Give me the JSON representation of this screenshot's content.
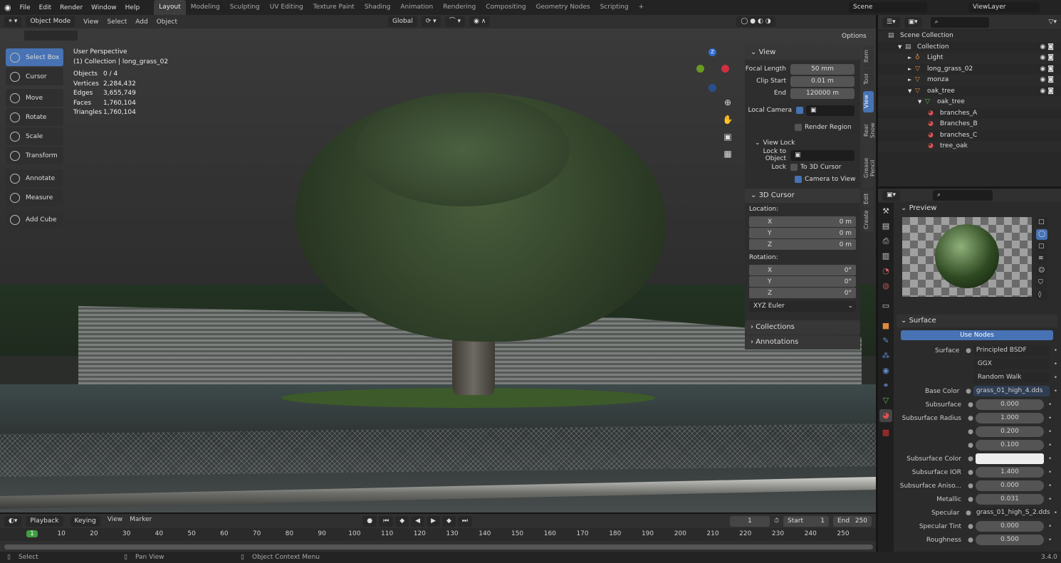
{
  "menu": [
    "File",
    "Edit",
    "Render",
    "Window",
    "Help"
  ],
  "workspaces": [
    "Layout",
    "Modeling",
    "Sculpting",
    "UV Editing",
    "Texture Paint",
    "Shading",
    "Animation",
    "Rendering",
    "Compositing",
    "Geometry Nodes",
    "Scripting",
    "+"
  ],
  "active_workspace": "Layout",
  "scene": "Scene",
  "view_layer": "ViewLayer",
  "viewport_header": {
    "mode": "Object Mode",
    "menus": [
      "View",
      "Select",
      "Add",
      "Object"
    ],
    "orientation": "Global",
    "options": "Options"
  },
  "toolbar": [
    "Select Box",
    "Cursor",
    "Move",
    "Rotate",
    "Scale",
    "Transform",
    "Annotate",
    "Measure",
    "Add Cube"
  ],
  "overlay": {
    "title": "User Perspective",
    "subtitle": "(1) Collection | long_grass_02",
    "stats": [
      [
        "Objects",
        "0 / 4"
      ],
      [
        "Vertices",
        "2,284,432"
      ],
      [
        "Edges",
        "3,655,749"
      ],
      [
        "Faces",
        "1,760,104"
      ],
      [
        "Triangles",
        "1,760,104"
      ]
    ]
  },
  "npanel": {
    "view_header": "View",
    "focal_label": "Focal Length",
    "focal": "50 mm",
    "clip_start_label": "Clip Start",
    "clip_start": "0.01 m",
    "end_label": "End",
    "end": "120000 m",
    "local_camera": "Local Camera",
    "render_region": "Render Region",
    "view_lock": "View Lock",
    "lock_to_object": "Lock to Object",
    "lock": "Lock",
    "to_3d_cursor": "To 3D Cursor",
    "camera_to_view": "Camera to View",
    "cursor_header": "3D Cursor",
    "location": "Location:",
    "loc": [
      [
        "X",
        "0 m"
      ],
      [
        "Y",
        "0 m"
      ],
      [
        "Z",
        "0 m"
      ]
    ],
    "rotation": "Rotation:",
    "rot": [
      [
        "X",
        "0°"
      ],
      [
        "Y",
        "0°"
      ],
      [
        "Z",
        "0°"
      ]
    ],
    "euler": "XYZ Euler",
    "collections": "Collections",
    "annotations": "Annotations"
  },
  "ntabs": [
    "Item",
    "Tool",
    "View",
    "Real Snow",
    "Grease Pencil",
    "Edit",
    "Create"
  ],
  "active_ntab": "View",
  "outliner": [
    {
      "label": "Scene Collection",
      "indent": 0
    },
    {
      "label": "Collection",
      "indent": 1
    },
    {
      "label": "Light",
      "indent": 2,
      "color": "#e08a3c"
    },
    {
      "label": "long_grass_02",
      "indent": 2,
      "color": "#e08a3c"
    },
    {
      "label": "monza",
      "indent": 2,
      "color": "#e08a3c"
    },
    {
      "label": "oak_tree",
      "indent": 2,
      "color": "#e08a3c"
    },
    {
      "label": "oak_tree",
      "indent": 3,
      "color": "#5dbb4e"
    },
    {
      "label": "branches_A",
      "indent": 4,
      "color": "#e05050"
    },
    {
      "label": "Branches_B",
      "indent": 4,
      "color": "#e05050"
    },
    {
      "label": "branches_C",
      "indent": 4,
      "color": "#e05050"
    },
    {
      "label": "tree_oak",
      "indent": 4,
      "color": "#e05050"
    }
  ],
  "properties": {
    "preview": "Preview",
    "surface_header": "Surface",
    "use_nodes": "Use Nodes",
    "rows": [
      [
        "Surface",
        "Principled BSDF",
        "text"
      ],
      [
        "",
        "GGX",
        "select"
      ],
      [
        "",
        "Random Walk",
        "select"
      ],
      [
        "Base Color",
        "grass_01_high_4.dds",
        "text"
      ],
      [
        "Subsurface",
        "0.000",
        "num"
      ],
      [
        "Subsurface Radius",
        "1.000",
        "num"
      ],
      [
        "",
        "0.200",
        "num"
      ],
      [
        "",
        "0.100",
        "num"
      ],
      [
        "Subsurface Color",
        "",
        "color"
      ],
      [
        "Subsurface IOR",
        "1.400",
        "num"
      ],
      [
        "Subsurface Aniso...",
        "0.000",
        "num"
      ],
      [
        "Metallic",
        "0.031",
        "num"
      ],
      [
        "Specular",
        "grass_01_high_S_2.dds",
        "text"
      ],
      [
        "Specular Tint",
        "0.000",
        "num"
      ],
      [
        "Roughness",
        "0.500",
        "num"
      ]
    ]
  },
  "timeline": {
    "menus": [
      "Playback",
      "Keying",
      "View",
      "Marker"
    ],
    "current": "1",
    "start_label": "Start",
    "start": "1",
    "end_label": "End",
    "end": "250",
    "ticks": [
      "1",
      "10",
      "20",
      "30",
      "40",
      "50",
      "60",
      "70",
      "80",
      "90",
      "100",
      "110",
      "120",
      "130",
      "140",
      "150",
      "160",
      "170",
      "180",
      "190",
      "200",
      "210",
      "220",
      "230",
      "240",
      "250"
    ]
  },
  "status": {
    "select": "Select",
    "pan": "Pan View",
    "context": "Object Context Menu",
    "version": "3.4.0"
  },
  "colors": {
    "accent": "#4772b3",
    "frame": "#3f9e3f"
  }
}
